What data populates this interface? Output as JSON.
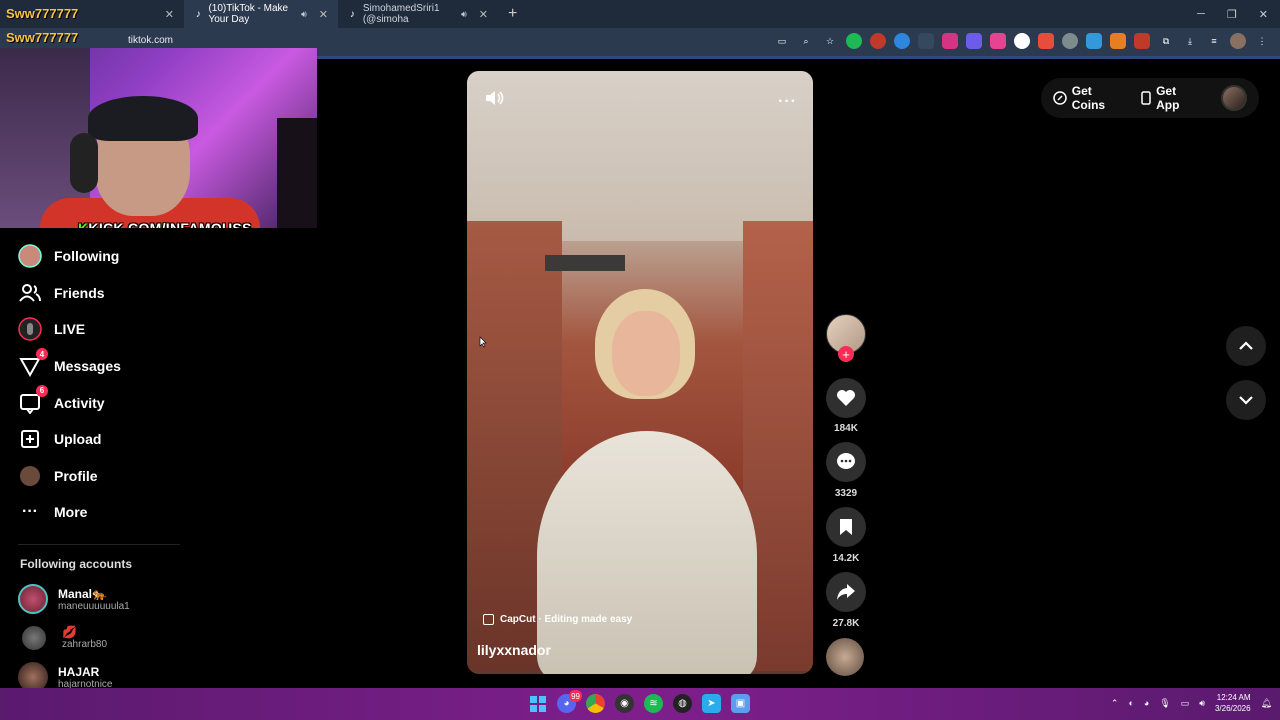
{
  "browser": {
    "tabs": [
      {
        "label": "",
        "has_close": true
      },
      {
        "label": "(10)TikTok - Make Your Day",
        "active": true
      },
      {
        "label": "SimohamedSriri1 (@simoha"
      }
    ],
    "url": "tiktok.com"
  },
  "stream_overlay": {
    "username_1": "Sww777777",
    "username_2": "Sww777777",
    "kick_k": "K",
    "kick_text": "KICK.COM/INFAMOUSS"
  },
  "sidebar": {
    "items": [
      {
        "label": "Following",
        "icon": "avatar-icon"
      },
      {
        "label": "Friends",
        "icon": "friends-icon"
      },
      {
        "label": "LIVE",
        "icon": "live-icon"
      },
      {
        "label": "Messages",
        "icon": "messages-icon",
        "badge": "4"
      },
      {
        "label": "Activity",
        "icon": "activity-icon",
        "badge": "6"
      },
      {
        "label": "Upload",
        "icon": "upload-icon"
      },
      {
        "label": "Profile",
        "icon": "profile-icon"
      },
      {
        "label": "More",
        "icon": "more-icon"
      }
    ],
    "following_title": "Following accounts",
    "accounts": [
      {
        "name": "Manal🐅",
        "username": "maneuuuuuula1"
      },
      {
        "name": "💋",
        "username": "zahrarb80"
      },
      {
        "name": "HAJAR",
        "username": "hajarnotnice"
      }
    ]
  },
  "video": {
    "effect_label": "CapCut · Editing made easy",
    "author": "lilyxxnador",
    "likes": "184K",
    "comments": "3329",
    "saves": "14.2K",
    "shares": "27.8K"
  },
  "topbar": {
    "get_coins": "Get Coins",
    "get_app": "Get App"
  },
  "taskbar": {
    "time": "12:24 AM",
    "date": "3/26/2026",
    "discord_badge": "99"
  },
  "colors": {
    "accent": "#fe2c55",
    "kick_green": "#53fc18",
    "taskbar": "#7e1f8c"
  }
}
